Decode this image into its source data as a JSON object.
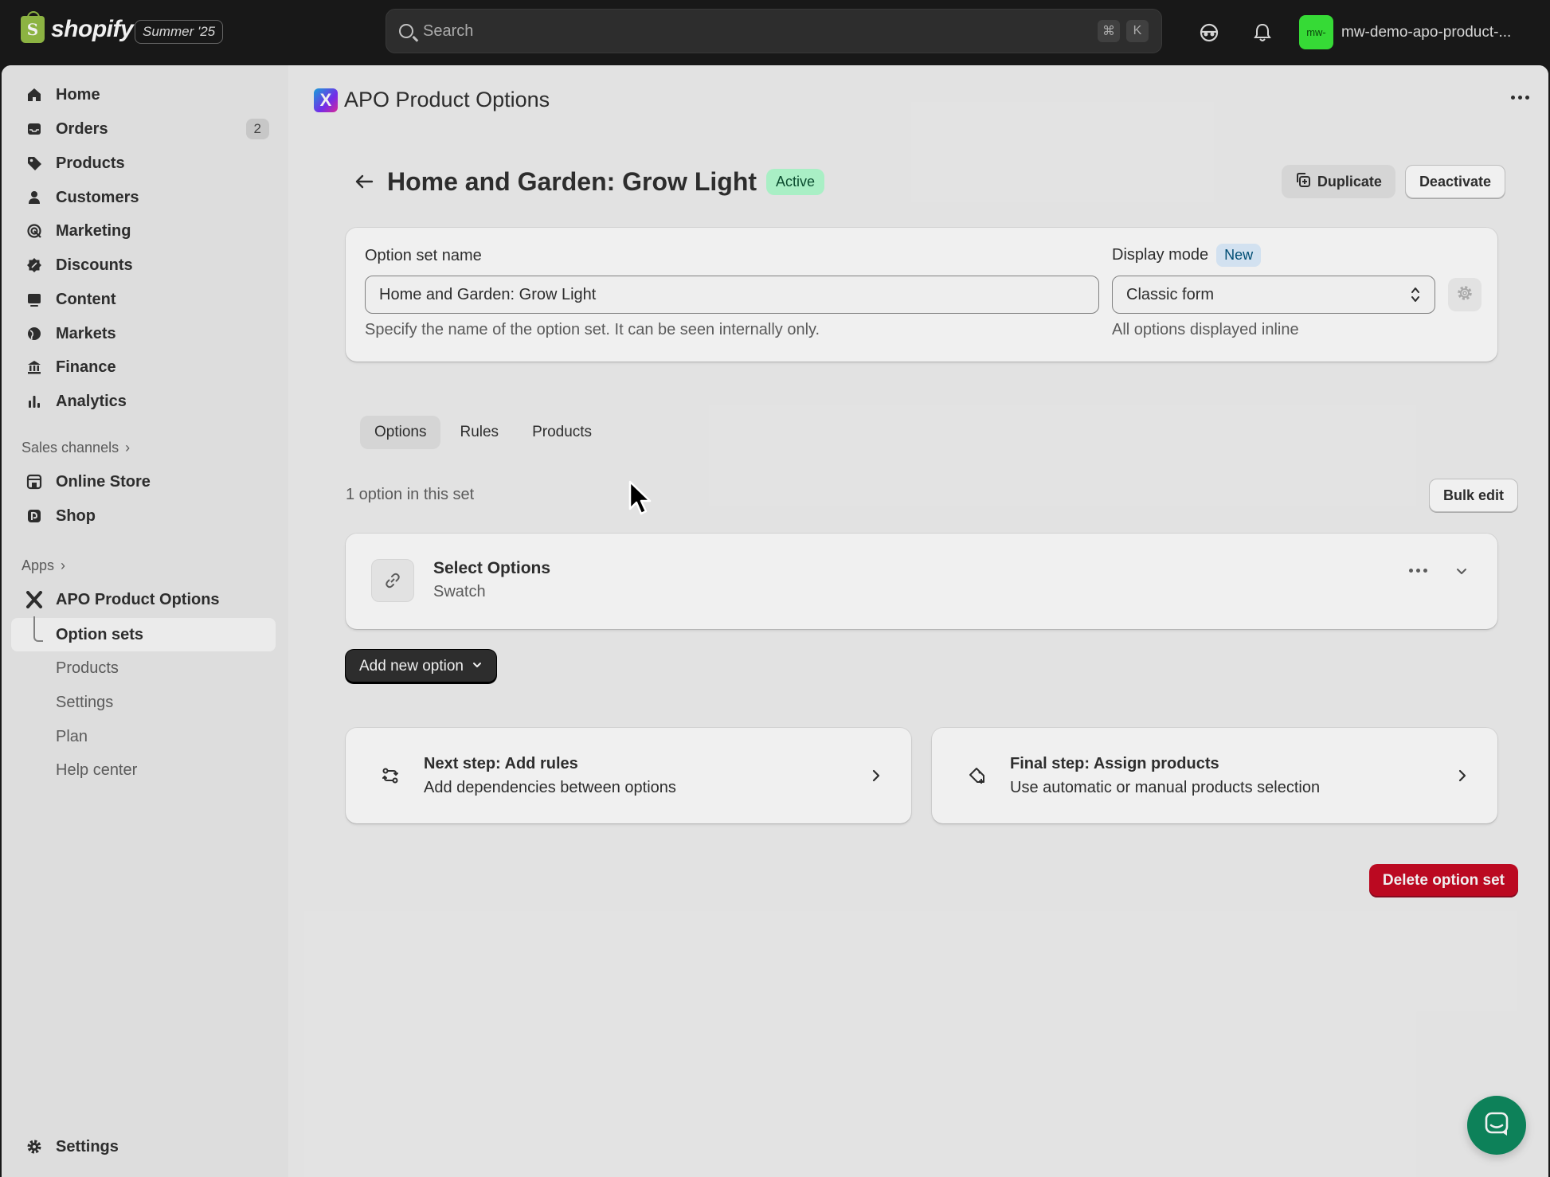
{
  "topbar": {
    "logo_text": "shopify",
    "edition": "Summer '25",
    "search_placeholder": "Search",
    "shortcut_keys": [
      "⌘",
      "K"
    ],
    "store_avatar": "mw-",
    "store_name": "mw-demo-apo-product-..."
  },
  "sidebar": {
    "items": [
      {
        "label": "Home",
        "icon": "home-icon"
      },
      {
        "label": "Orders",
        "icon": "inbox-icon",
        "badge": "2"
      },
      {
        "label": "Products",
        "icon": "tag-icon"
      },
      {
        "label": "Customers",
        "icon": "person-icon"
      },
      {
        "label": "Marketing",
        "icon": "target-icon"
      },
      {
        "label": "Discounts",
        "icon": "discount-icon"
      },
      {
        "label": "Content",
        "icon": "image-icon"
      },
      {
        "label": "Markets",
        "icon": "globe-icon"
      },
      {
        "label": "Finance",
        "icon": "bank-icon"
      },
      {
        "label": "Analytics",
        "icon": "bar-chart-icon"
      }
    ],
    "sales_channels_label": "Sales channels",
    "channels": [
      {
        "label": "Online Store",
        "icon": "store-icon"
      },
      {
        "label": "Shop",
        "icon": "shop-icon"
      }
    ],
    "apps_label": "Apps",
    "app_name": "APO Product Options",
    "app_subitems": [
      "Option sets",
      "Products",
      "Settings",
      "Plan",
      "Help center"
    ],
    "settings_label": "Settings"
  },
  "app_header": {
    "logo_letter": "X",
    "title": "APO Product Options"
  },
  "page": {
    "title": "Home and Garden: Grow Light",
    "status": "Active",
    "duplicate_label": "Duplicate",
    "deactivate_label": "Deactivate"
  },
  "form": {
    "name_label": "Option set name",
    "name_value": "Home and Garden: Grow Light",
    "name_help": "Specify the name of the option set. It can be seen internally only.",
    "display_label": "Display mode",
    "display_badge": "New",
    "display_value": "Classic form",
    "display_help": "All options displayed inline"
  },
  "tabs": [
    "Options",
    "Rules",
    "Products"
  ],
  "options": {
    "count_text": "1 option in this set",
    "bulk_edit_label": "Bulk edit",
    "items": [
      {
        "title": "Select Options",
        "subtitle": "Swatch"
      }
    ],
    "add_label": "Add new option"
  },
  "steps": [
    {
      "title": "Next step: Add rules",
      "subtitle": "Add dependencies between options",
      "icon": "rules-icon"
    },
    {
      "title": "Final step: Assign products",
      "subtitle": "Use automatic or manual products selection",
      "icon": "tag-plus-icon"
    }
  ],
  "delete_label": "Delete option set",
  "colors": {
    "primary": "#303030",
    "active_badge": "#b4fed2",
    "danger": "#c70a24",
    "chat": "#0e8a5f"
  }
}
